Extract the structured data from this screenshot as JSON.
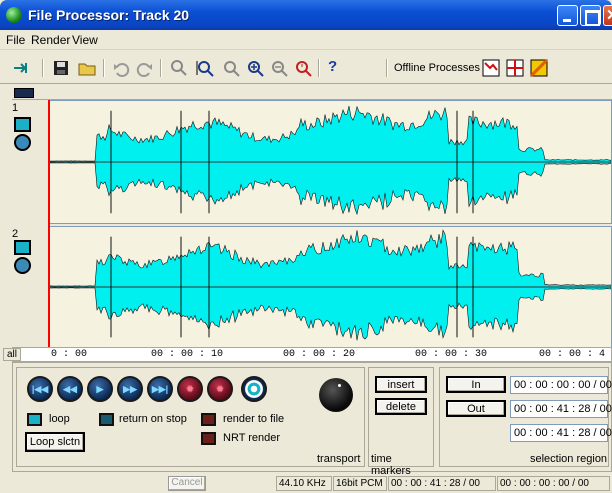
{
  "window": {
    "title": "File Processor: Track 20",
    "close_glyph": "✕"
  },
  "menu": {
    "items": [
      "File",
      "Render",
      "View"
    ]
  },
  "toolbar": {
    "icons": [
      "pin-icon",
      "save-icon",
      "open-folder-icon",
      "undo-icon",
      "redo-icon",
      "zoom-selection-icon",
      "zoom-fit-icon",
      "zoom-track-icon",
      "zoom-in-icon",
      "zoom-out-icon",
      "zoom-all-icon",
      "help-icon"
    ],
    "help_glyph": "?",
    "offline_label": "Offline Processes",
    "offline_icons": [
      "envelope-icon",
      "marker-icon",
      "fade-icon"
    ]
  },
  "tracks": [
    {
      "number": "1"
    },
    {
      "number": "2"
    }
  ],
  "ruler": {
    "all_label": "all",
    "labels": [
      "0 : 00",
      "00 : 00 : 10",
      "00 : 00 : 20",
      "00 : 00 : 30",
      "00 : 00 : 4"
    ]
  },
  "transport": {
    "loop_label": "loop",
    "return_on_stop_label": "return on stop",
    "render_to_file_label": "render to file",
    "nrt_render_label": "NRT render",
    "loop_selection_label": "Loop slctn",
    "group_label": "transport",
    "buttons": [
      "skip-back-icon",
      "rewind-icon",
      "play-icon",
      "fast-forward-icon",
      "skip-forward-icon",
      "record-icon",
      "record-arm-icon",
      "stop-icon"
    ]
  },
  "time_markers": {
    "insert_label": "insert",
    "delete_label": "delete",
    "group_label": "time markers"
  },
  "selection": {
    "in_label": "In",
    "out_label": "Out",
    "in_value": "00 : 00 : 00 : 00 / 00",
    "out_value": "00 : 00 : 41 : 28 / 00",
    "length_value": "00 : 00 : 41 : 28 / 00",
    "group_label": "selection region"
  },
  "status": {
    "cancel_label": "Cancel",
    "sample_rate": "44.10 KHz",
    "format": "16bit PCM",
    "position": "00 : 00 : 41 : 28 / 00",
    "cursor": "00 : 00 : 00 : 00 / 00"
  },
  "colors": {
    "waveform": "#00f0f0",
    "title_bar": "#0b4fd4",
    "cursor": "#ff0000"
  }
}
